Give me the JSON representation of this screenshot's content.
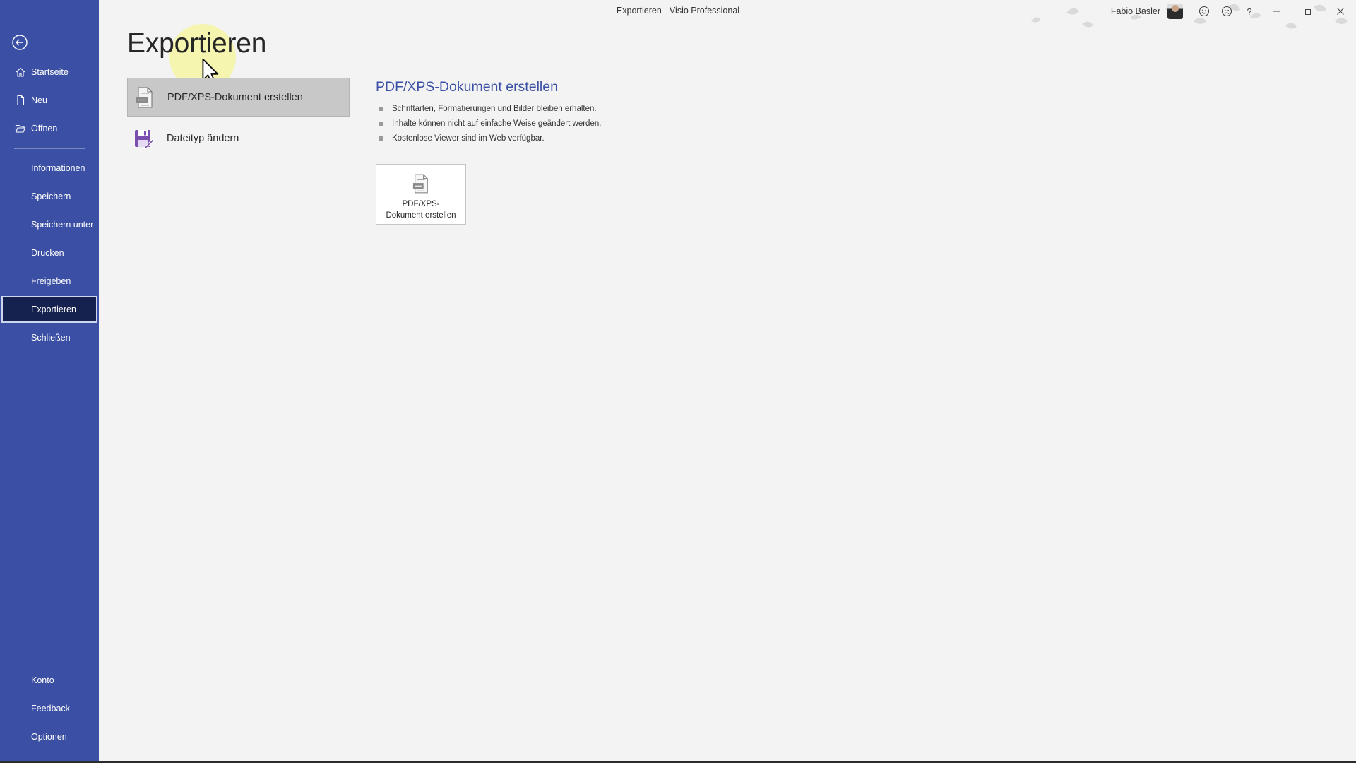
{
  "window": {
    "title": "Exportieren  -  Visio Professional",
    "user_name": "Fabio Basler",
    "help_label": "?"
  },
  "colors": {
    "sidebar": "#3b50a4",
    "sidebar_active": "#15214f",
    "accent_title": "#3b50a4",
    "background": "#f3f3f3"
  },
  "sidebar": {
    "top_items": [
      {
        "label": "Startseite",
        "icon": "home-icon"
      },
      {
        "label": "Neu",
        "icon": "new-document-icon"
      },
      {
        "label": "Öffnen",
        "icon": "folder-open-icon"
      }
    ],
    "middle_items": [
      {
        "label": "Informationen"
      },
      {
        "label": "Speichern"
      },
      {
        "label": "Speichern unter"
      },
      {
        "label": "Drucken"
      },
      {
        "label": "Freigeben"
      },
      {
        "label": "Exportieren",
        "active": true
      },
      {
        "label": "Schließen"
      }
    ],
    "bottom_items": [
      {
        "label": "Konto"
      },
      {
        "label": "Feedback"
      },
      {
        "label": "Optionen"
      }
    ]
  },
  "main": {
    "page_title": "Exportieren",
    "options": [
      {
        "label": "PDF/XPS-Dokument erstellen",
        "icon": "pdf-document-icon",
        "selected": true
      },
      {
        "label": "Dateityp ändern",
        "icon": "change-filetype-icon",
        "selected": false
      }
    ],
    "detail": {
      "title": "PDF/XPS-Dokument erstellen",
      "bullets": [
        "Schriftarten, Formatierungen und Bilder bleiben erhalten.",
        "Inhalte können nicht auf einfache Weise geändert werden.",
        "Kostenlose Viewer sind im Web verfügbar."
      ],
      "button_line1": "PDF/XPS-",
      "button_line2": "Dokument erstellen"
    }
  }
}
